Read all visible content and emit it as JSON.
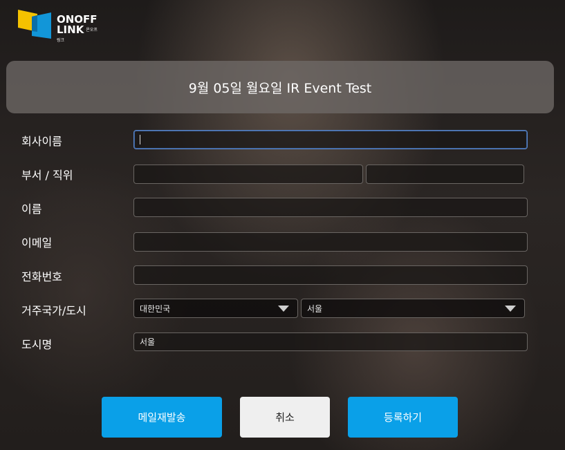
{
  "brand": {
    "line1": "ONOFF",
    "line2": "LINK",
    "sub": "온오프링크",
    "colors": {
      "yellow": "#f5c200",
      "blue": "#1296d8"
    }
  },
  "title": "9월 05일 월요일 IR Event Test",
  "form": {
    "company": {
      "label": "회사이름",
      "value": ""
    },
    "dept_title": {
      "label": "부서 / 직위",
      "dept_value": "",
      "title_value": ""
    },
    "name": {
      "label": "이름",
      "value": ""
    },
    "email": {
      "label": "이메일",
      "value": ""
    },
    "phone": {
      "label": "전화번호",
      "value": ""
    },
    "country_city": {
      "label": "거주국가/도시",
      "country": "대한민국",
      "city": "서울"
    },
    "city_name": {
      "label": "도시명",
      "value": "서울"
    }
  },
  "buttons": {
    "resend": "메일재발송",
    "cancel": "취소",
    "register": "등록하기"
  },
  "accent": {
    "button_blue": "#0aa0e8",
    "focus_border": "#5b86c8"
  }
}
